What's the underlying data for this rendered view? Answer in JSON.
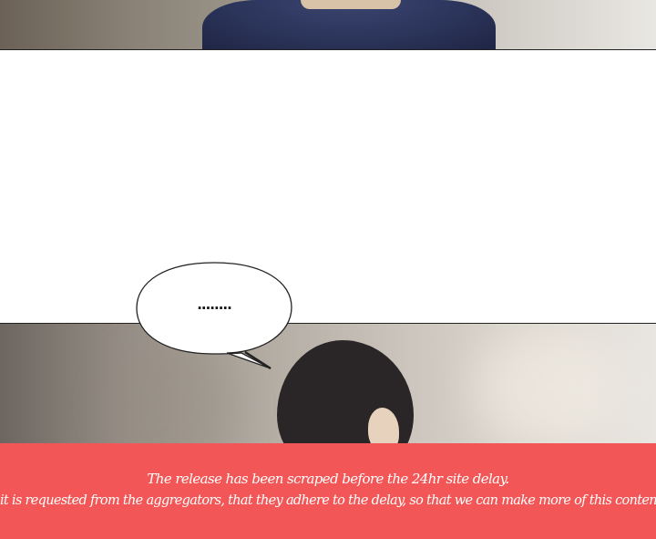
{
  "speech_bubble": {
    "text": "........"
  },
  "notice": {
    "line1": "The release has been scraped before the 24hr site delay.",
    "line2": "it is requested from the aggregators, that they adhere to the delay, so that we can make more of this content",
    "background_color": "#f25656",
    "text_color": "#ffffff"
  }
}
